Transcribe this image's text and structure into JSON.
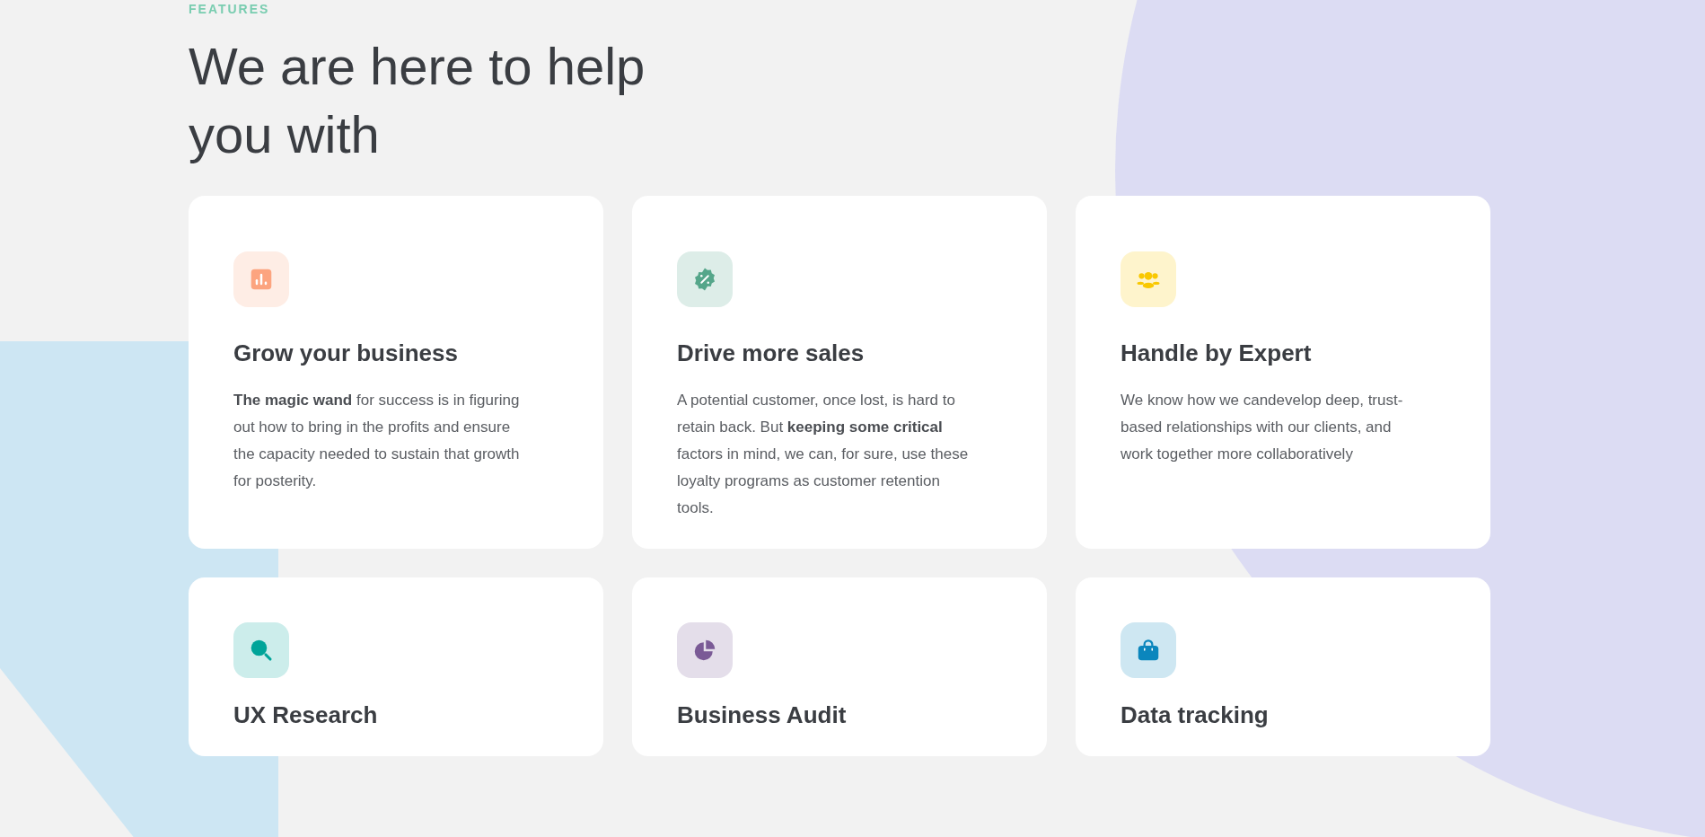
{
  "eyebrow": "FEATURES",
  "heading": "We are here to help you with",
  "cards": [
    {
      "color": "#fca47f",
      "title": "Grow your business",
      "text": "**The magic wand** for success is in figuring out how to bring in the profits and ensure the capacity needed to sustain that growth for posterity."
    },
    {
      "color": "#55a68a",
      "title": "Drive more sales",
      "text": "A potential customer, once lost, is hard to retain back. But **keeping some critical** factors in mind, we can, for sure, use these loyalty programs as customer retention tools."
    },
    {
      "color": "#f9c800",
      "title": "Handle by Expert",
      "text": "We know how we candevelop deep, trust-based relationships with our clients, and work together more collaboratively"
    },
    {
      "color": "#00a499",
      "title": "UX Research"
    },
    {
      "color": "#7a5a96",
      "title": "Business Audit"
    },
    {
      "color": "#0b86bd",
      "title": "Data tracking"
    }
  ]
}
